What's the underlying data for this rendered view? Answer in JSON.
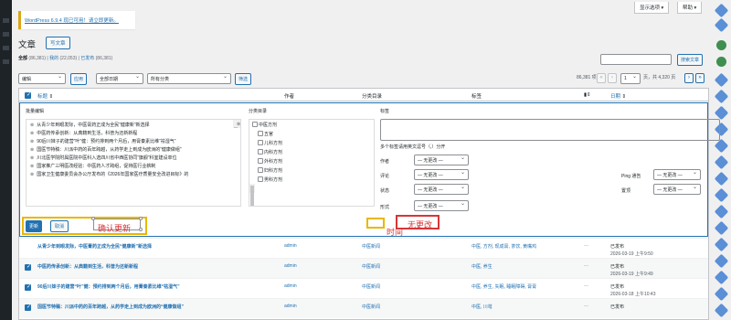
{
  "screen_options": {
    "screen_label": "显示选项 ▾",
    "help_label": "帮助 ▾"
  },
  "notice": {
    "text": "WordPress 6.9.4 现已可用！",
    "link": "请立即更新。"
  },
  "page": {
    "title": "文章",
    "add_new": "写文章"
  },
  "views": {
    "all": "全部",
    "all_count": "(86,381)",
    "mine": "我的",
    "mine_count": "(22,053)",
    "published": "已发布",
    "published_count": "(86,381)"
  },
  "search": {
    "button": "搜索文章"
  },
  "filters": {
    "bulk_action": "编辑",
    "apply": "应用",
    "all_dates": "全部日期",
    "all_categories": "所有分类",
    "filter": "筛选"
  },
  "pagination": {
    "items": "86,381 项",
    "current_page": "1",
    "of_pages": "页，共 4,320 页"
  },
  "table_head": {
    "title": "标题",
    "author": "作者",
    "category": "分类目录",
    "tags": "标签",
    "date": "日期"
  },
  "bulk_edit": {
    "legend": "批量编辑",
    "posts": [
      "从青少年到眼发际，中医膏药正成为全民“健康新”新选择",
      "中医药传承创新：从典籍到生活，科普为还新新程",
      "90后川妹子的建营“叶”健：预约排到两个月后，用膏秦素比维“祛湿气”",
      "国医节特稿：川派中药的百年跨越，从药学走上到成为欧洲的“健康做组”",
      "川北医学院附属医院中医科入选四川省中西医协同“旗舰”科室建设单位",
      "国家推广三明医改经验：中医药人才跨组，促持医行业薪制",
      "国家卫生健康委员会办公厅发布的《2026年国家医疗质量安全改进目标》的"
    ],
    "category_legend": "分类目录",
    "categories": [
      "中医方剂",
      "五官",
      "儿科方剂",
      "内科方剂",
      "外科方剂",
      "妇科方剂",
      "男科方剂"
    ],
    "tags_legend": "标签",
    "tags_hint": "多个标签请用英文逗号（,）分开",
    "fields": [
      {
        "label": "作者",
        "value": "— 无更改 —"
      },
      {
        "label": "评论",
        "value": "— 无更改 —"
      },
      {
        "label": "状态",
        "value": "— 无更改 —"
      },
      {
        "label": "形式",
        "value": "— 无更改 —"
      }
    ],
    "ping": {
      "label": "Ping 通告",
      "value": "— 无更改 —"
    },
    "sticky": {
      "label": "置顶",
      "value": "— 无更改 —"
    },
    "update": "更新",
    "cancel": "取消"
  },
  "annotations": {
    "confirm": "确认更新",
    "time": "时间",
    "no_change": "无更改"
  },
  "rows": [
    {
      "title": "从青少年到眼发际，中医膏药正成为全民“健康新”新选择",
      "author": "admin",
      "category": "中医新闻",
      "tags": "中医, 方剂, 现成膏, 茶饮, 黄嘴鸡",
      "comments": "—",
      "status": "已发布",
      "date": "2026-03-19 上午9:50"
    },
    {
      "title": "中医药传承创新：从典籍到生活，科普为还新新程",
      "author": "admin",
      "category": "中医新闻",
      "tags": "中医, 养生",
      "comments": "—",
      "status": "已发布",
      "date": "2026-03-19 上午9:49"
    },
    {
      "title": "90后川妹子的建营“叶”健：预约排到两个月后，用膏秦素比维“祛湿气”",
      "author": "admin",
      "category": "中医新闻",
      "tags": "中医, 养生, 失眠, 睡眠障碍, 膏膏",
      "comments": "—",
      "status": "已发布",
      "date": "2026-03-18 上午10:43"
    },
    {
      "title": "国医节特稿：川派中药的百年跨越，从药学走上到成为欧洲的“健康做组”",
      "author": "admin",
      "category": "中医新闻",
      "tags": "中医, 川芎",
      "comments": "—",
      "status": "已发布",
      "date": ""
    }
  ]
}
